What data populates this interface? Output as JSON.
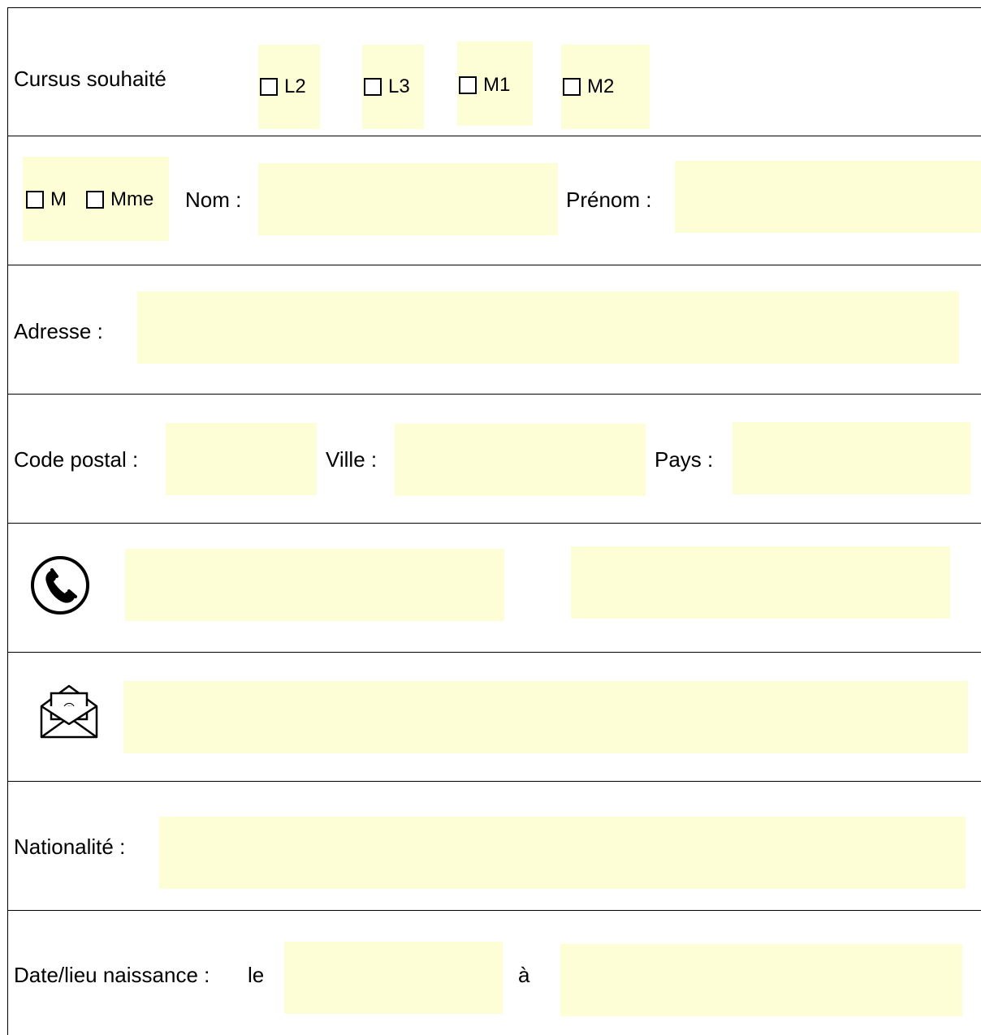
{
  "cursus": {
    "label": "Cursus souhaité",
    "options": [
      "L2",
      "L3",
      "M1",
      "M2"
    ]
  },
  "identity": {
    "civility": [
      "M",
      "Mme"
    ],
    "nom_label": "Nom :",
    "prenom_label": "Prénom :"
  },
  "address": {
    "label": "Adresse :"
  },
  "location": {
    "code_postal_label": "Code postal :",
    "ville_label": "Ville :",
    "pays_label": "Pays :"
  },
  "phone": {
    "icon": "phone-icon"
  },
  "email": {
    "icon": "email-envelope-icon"
  },
  "nationality": {
    "label": "Nationalité :"
  },
  "birth": {
    "label": "Date/lieu naissance :",
    "le_label": "le",
    "a_label": "à"
  },
  "colors": {
    "field_bg": "#fefed6",
    "border": "#000000"
  }
}
